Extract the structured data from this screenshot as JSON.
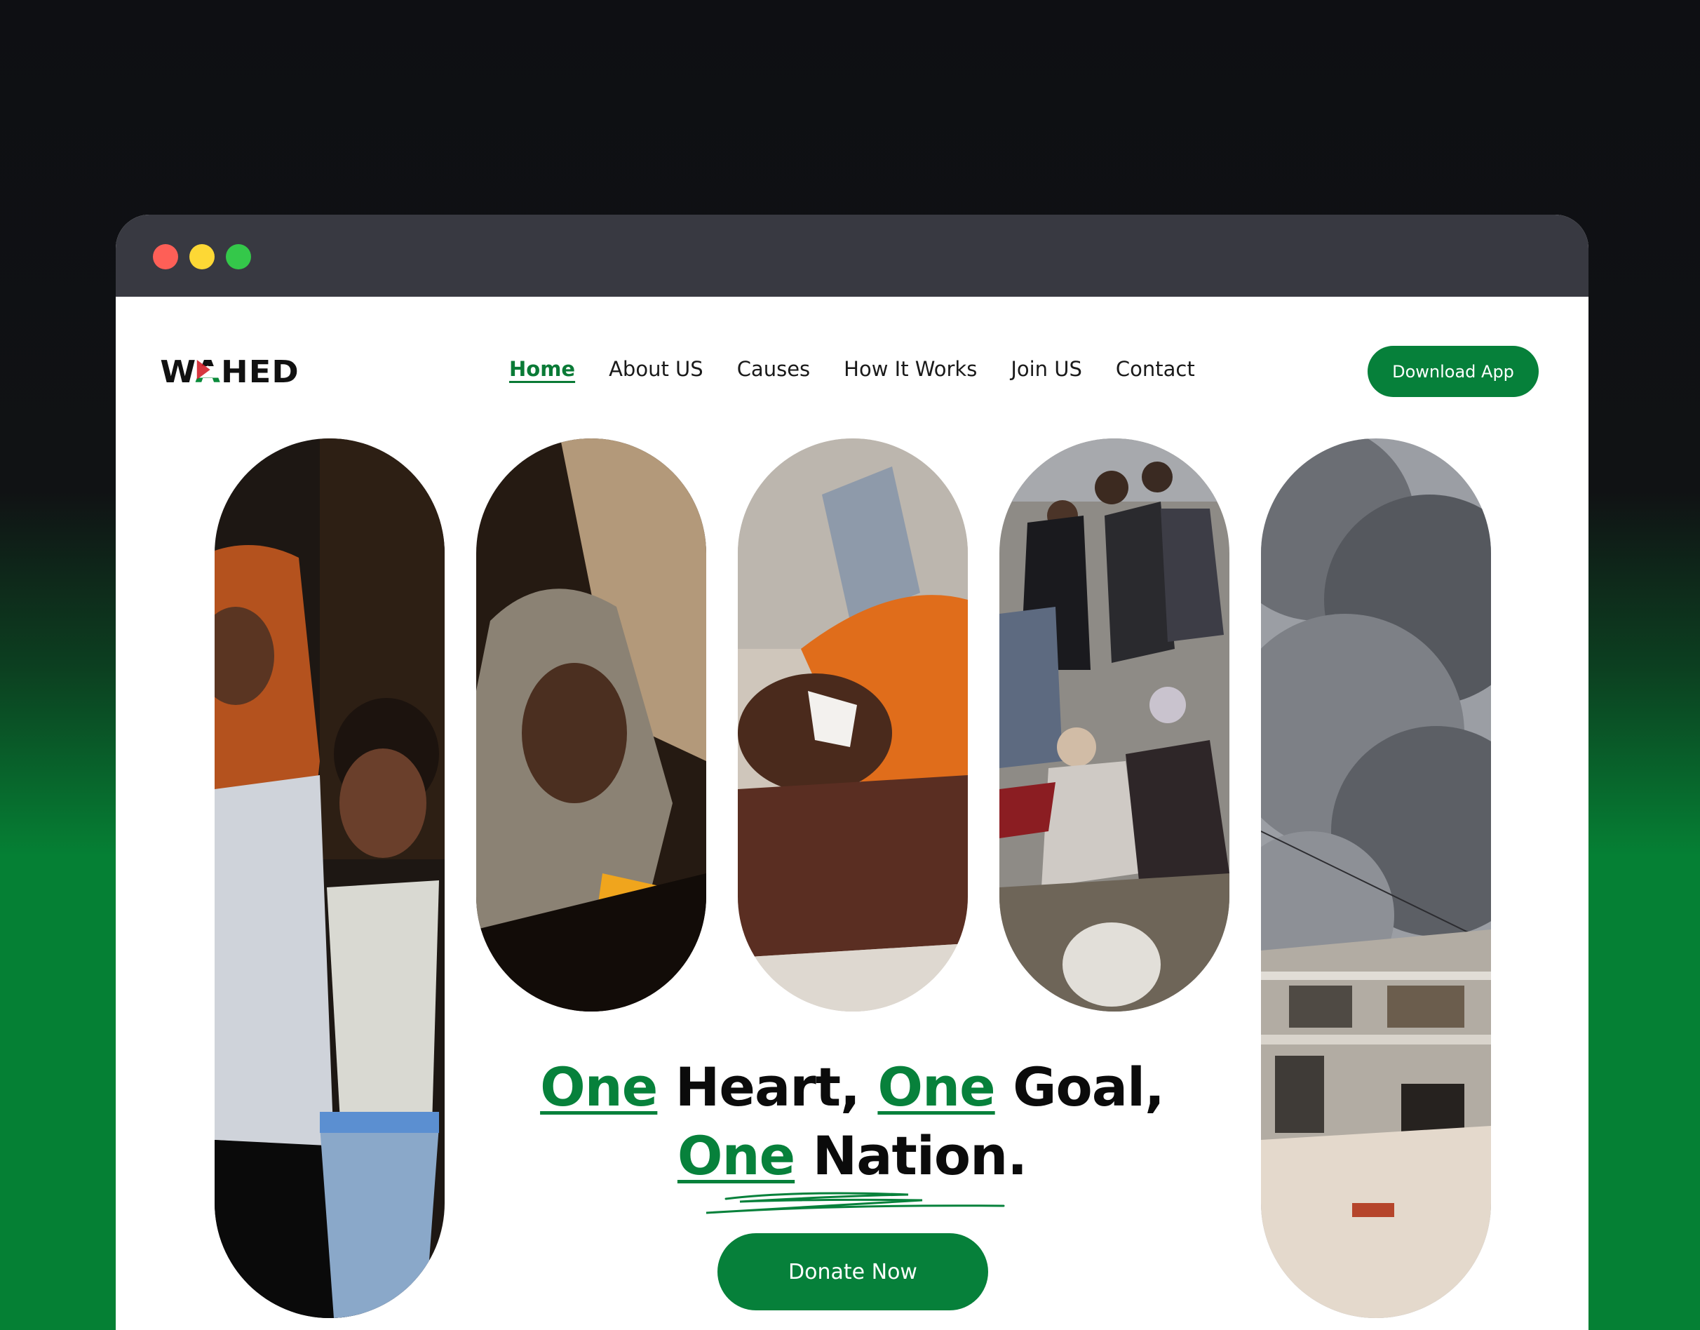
{
  "window": {
    "controls": [
      "close",
      "minimize",
      "maximize"
    ]
  },
  "header": {
    "logo": {
      "text": "WAHED",
      "icon": "flag-letter"
    },
    "nav": [
      {
        "label": "Home",
        "active": true
      },
      {
        "label": "About US"
      },
      {
        "label": "Causes"
      },
      {
        "label": "How It Works"
      },
      {
        "label": "Join US"
      },
      {
        "label": "Contact"
      }
    ],
    "cta": "Download App"
  },
  "hero": {
    "headline": {
      "w1": "One",
      "t1": " Heart, ",
      "w2": "One",
      "t2": " Goal,",
      "w3": "One",
      "t3": " Nation."
    },
    "cta": "Donate Now",
    "images": [
      "mother-and-child-photo",
      "woman-in-headscarf-photo",
      "injured-child-photo",
      "crowd-displaced-people-photo",
      "smoke-over-ruined-building-photo"
    ]
  },
  "colors": {
    "accent": "#06803a",
    "titlebar": "#383941",
    "text": "#0b0b0b"
  }
}
